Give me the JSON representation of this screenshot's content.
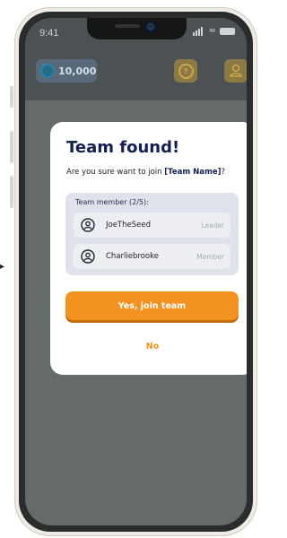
{
  "status_bar": {
    "time": "9:41"
  },
  "header": {
    "coins": "10,000",
    "help_glyph": "?"
  },
  "modal": {
    "title": "Team found!",
    "question_prefix": "Are you sure want to join ",
    "team_name": "[Team Name]",
    "question_suffix": "?",
    "members_label": "Team member (2/5):",
    "members": [
      {
        "name": "JoeTheSeed",
        "role": "Leader"
      },
      {
        "name": "Charliebrooke",
        "role": "Member"
      }
    ],
    "confirm_label": "Yes, join team",
    "cancel_label": "No"
  },
  "colors": {
    "accent": "#f39221",
    "title": "#14204e",
    "overlay": "#656a6a"
  },
  "icons": {
    "avatar": "user-circle-icon",
    "help": "help-circle-icon",
    "profile": "user-icon",
    "coin": "coin-icon"
  }
}
